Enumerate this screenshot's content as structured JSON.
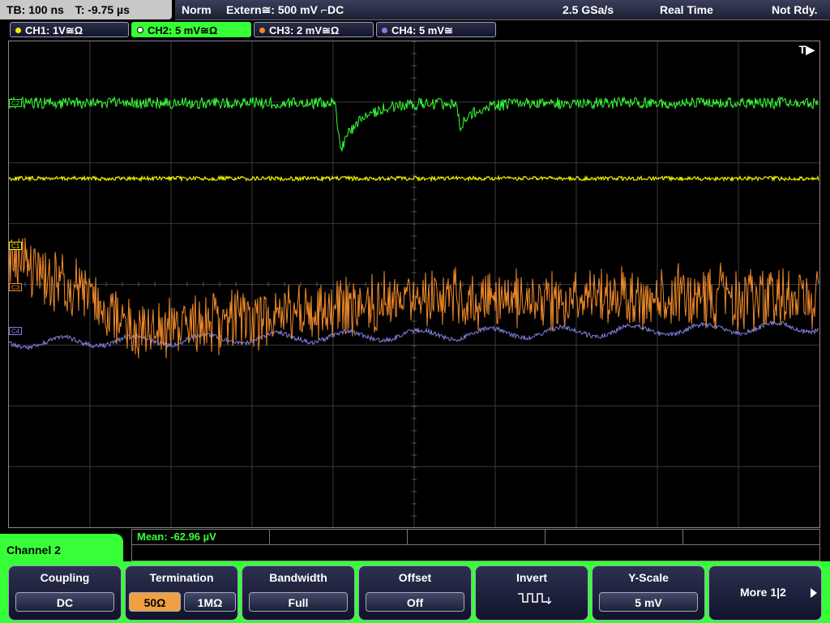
{
  "top": {
    "timebase": "TB: 100 ns",
    "trigger_time": "T: -9.75 µs",
    "mode": "Norm",
    "trigger_source": "Extern≅: 500 mV ⌐DC",
    "sample_rate": "2.5 GSa/s",
    "acq_mode": "Real Time",
    "status": "Not Rdy."
  },
  "channels": [
    {
      "label": "CH1: 1V≅Ω",
      "color": "#f0f000"
    },
    {
      "label": "CH2: 5 mV≅Ω",
      "color": "#37ff37"
    },
    {
      "label": "CH3: 2 mV≅Ω",
      "color": "#f08a2a"
    },
    {
      "label": "CH4: 5 mV≅",
      "color": "#8080e0"
    }
  ],
  "markers": {
    "c1": "C1",
    "c3": "C3",
    "c4": "C4",
    "c2": "C2",
    "trigger": "T▶"
  },
  "measurement": {
    "text": "Mean: -62.96 µV"
  },
  "menu": {
    "channel": "Channel 2",
    "coupling_title": "Coupling",
    "coupling_value": "DC",
    "termination_title": "Termination",
    "term_50": "50Ω",
    "term_1m": "1MΩ",
    "bandwidth_title": "Bandwidth",
    "bandwidth_value": "Full",
    "offset_title": "Offset",
    "offset_value": "Off",
    "invert_title": "Invert",
    "yscale_title": "Y-Scale",
    "yscale_value": "5 mV",
    "more": "More 1|2"
  }
}
